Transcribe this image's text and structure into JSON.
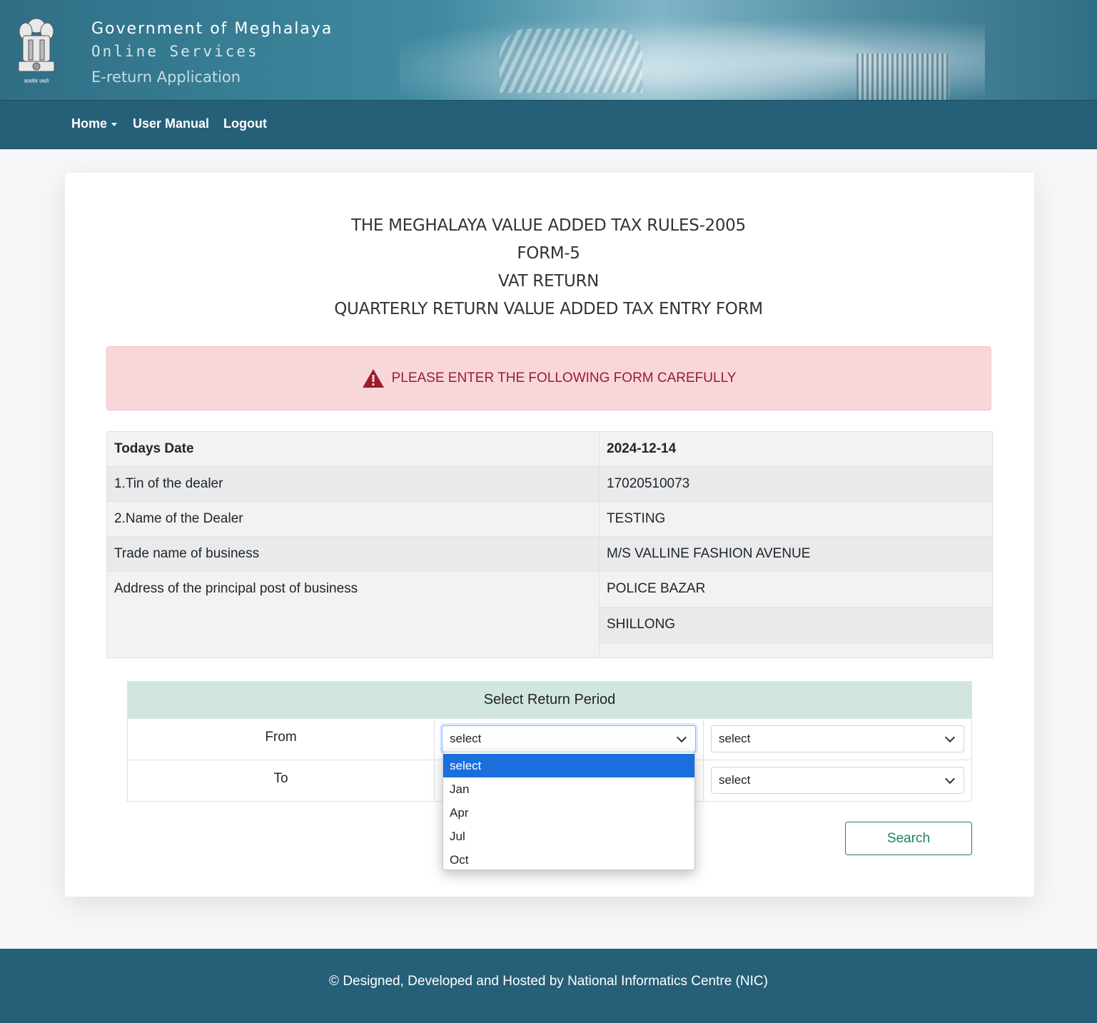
{
  "header": {
    "title": "Government of Meghalaya",
    "subtitle1": "Online Services",
    "subtitle2": "E-return Application",
    "emblem_caption": "सत्यमेव जयते"
  },
  "nav": {
    "home": "Home",
    "user_manual": "User Manual",
    "logout": "Logout"
  },
  "form_heading": {
    "line1": "THE MEGHALAYA VALUE ADDED TAX RULES-2005",
    "line2": "FORM-5",
    "line3": "VAT RETURN",
    "line4": "QUARTERLY RETURN VALUE ADDED TAX ENTRY FORM"
  },
  "alert": {
    "icon": "warning-triangle-icon",
    "text": "PLEASE ENTER THE FOLLOWING FORM CAREFULLY"
  },
  "dealer_info": {
    "todays_date_label": "Todays Date",
    "todays_date": "2024-12-14",
    "tin_label": "1.Tin of the dealer",
    "tin": "17020510073",
    "name_label": "2.Name of the Dealer",
    "name": "TESTING",
    "trade_name_label": "Trade name of business",
    "trade_name": "M/S VALLINE FASHION AVENUE",
    "address_label": "Address of the principal post of business",
    "address_line1": "POLICE BAZAR",
    "address_line2": "SHILLONG"
  },
  "return_period": {
    "heading": "Select Return Period",
    "from_label": "From",
    "to_label": "To",
    "from_month": "select",
    "from_year": "select",
    "to_year": "select",
    "month_options": [
      "select",
      "Jan",
      "Apr",
      "Jul",
      "Oct"
    ],
    "search_label": "Search"
  },
  "footer": {
    "text": "© Designed, Developed and Hosted by National Informatics Centre (NIC)"
  },
  "colors": {
    "navbar": "#255f78",
    "alert_bg": "#f8d7da",
    "alert_text": "#9b1c2c",
    "period_head_bg": "#d1e7dd",
    "success": "#198754",
    "option_highlight": "#1a6fdc"
  }
}
